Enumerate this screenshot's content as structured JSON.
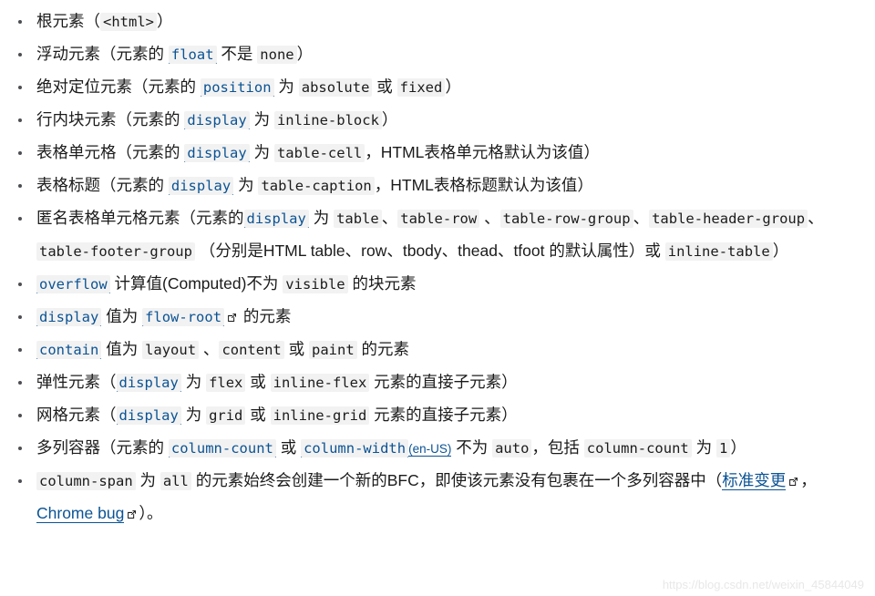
{
  "page": {
    "title": "BFC 触发条件列表",
    "text_color": "#1b1b1b",
    "link_color": "#0b5394",
    "code_background": "#f2f2f2",
    "background": "#ffffff",
    "watermark": "https://blog.csdn.net/weixin_45844049",
    "external_link_icon": "external-link-icon"
  },
  "list": {
    "items": [
      {
        "id": "root-element",
        "parts": [
          {
            "type": "text",
            "value": "根元素（"
          },
          {
            "type": "code",
            "value": "<html>"
          },
          {
            "type": "text",
            "value": "）"
          }
        ]
      },
      {
        "id": "floated-element",
        "parts": [
          {
            "type": "text",
            "value": "浮动元素（元素的 "
          },
          {
            "type": "codelink",
            "value": "float"
          },
          {
            "type": "text",
            "value": " 不是 "
          },
          {
            "type": "code",
            "value": "none"
          },
          {
            "type": "text",
            "value": "）"
          }
        ]
      },
      {
        "id": "absolutely-positioned-element",
        "parts": [
          {
            "type": "text",
            "value": "绝对定位元素（元素的 "
          },
          {
            "type": "codelink",
            "value": "position"
          },
          {
            "type": "text",
            "value": " 为 "
          },
          {
            "type": "code",
            "value": "absolute"
          },
          {
            "type": "text",
            "value": " 或 "
          },
          {
            "type": "code",
            "value": "fixed"
          },
          {
            "type": "text",
            "value": "）"
          }
        ]
      },
      {
        "id": "inline-block-element",
        "parts": [
          {
            "type": "text",
            "value": "行内块元素（元素的 "
          },
          {
            "type": "codelink",
            "value": "display"
          },
          {
            "type": "text",
            "value": " 为 "
          },
          {
            "type": "code",
            "value": "inline-block"
          },
          {
            "type": "text",
            "value": "）"
          }
        ]
      },
      {
        "id": "table-cell",
        "parts": [
          {
            "type": "text",
            "value": "表格单元格（元素的 "
          },
          {
            "type": "codelink",
            "value": "display"
          },
          {
            "type": "text",
            "value": " 为 "
          },
          {
            "type": "code",
            "value": "table-cell"
          },
          {
            "type": "text",
            "value": "，HTML表格单元格默认为该值）"
          }
        ]
      },
      {
        "id": "table-caption",
        "parts": [
          {
            "type": "text",
            "value": "表格标题（元素的 "
          },
          {
            "type": "codelink",
            "value": "display"
          },
          {
            "type": "text",
            "value": " 为 "
          },
          {
            "type": "code",
            "value": "table-caption"
          },
          {
            "type": "text",
            "value": "，HTML表格标题默认为该值）"
          }
        ]
      },
      {
        "id": "anonymous-table-cell",
        "parts": [
          {
            "type": "text",
            "value": "匿名表格单元格元素（元素的"
          },
          {
            "type": "codelink",
            "value": "display"
          },
          {
            "type": "text",
            "value": " 为 "
          },
          {
            "type": "code",
            "value": "table"
          },
          {
            "type": "text",
            "value": "、"
          },
          {
            "type": "code",
            "value": "table-row"
          },
          {
            "type": "text",
            "value": " 、"
          },
          {
            "type": "code",
            "value": "table-row-group"
          },
          {
            "type": "text",
            "value": "、"
          },
          {
            "type": "code",
            "value": "table-header-group"
          },
          {
            "type": "text",
            "value": "、"
          },
          {
            "type": "code",
            "value": "table-footer-group"
          },
          {
            "type": "text",
            "value": " （分别是HTML table、row、tbody、thead、tfoot 的默认属性）或 "
          },
          {
            "type": "code",
            "value": "inline-table"
          },
          {
            "type": "text",
            "value": "）"
          }
        ]
      },
      {
        "id": "overflow-not-visible",
        "parts": [
          {
            "type": "codelink",
            "value": "overflow"
          },
          {
            "type": "text",
            "value": " 计算值(Computed)不为 "
          },
          {
            "type": "code",
            "value": "visible"
          },
          {
            "type": "text",
            "value": " 的块元素"
          }
        ]
      },
      {
        "id": "display-flow-root",
        "parts": [
          {
            "type": "codelink",
            "value": "display"
          },
          {
            "type": "text",
            "value": " 值为 "
          },
          {
            "type": "codelink",
            "value": "flow-root",
            "external": true
          },
          {
            "type": "text",
            "value": " 的元素"
          }
        ]
      },
      {
        "id": "contain-values",
        "parts": [
          {
            "type": "codelink",
            "value": "contain"
          },
          {
            "type": "text",
            "value": " 值为 "
          },
          {
            "type": "code",
            "value": "layout"
          },
          {
            "type": "text",
            "value": " 、"
          },
          {
            "type": "code",
            "value": "content"
          },
          {
            "type": "text",
            "value": " 或 "
          },
          {
            "type": "code",
            "value": "paint"
          },
          {
            "type": "text",
            "value": " 的元素"
          }
        ]
      },
      {
        "id": "flex-item",
        "parts": [
          {
            "type": "text",
            "value": "弹性元素（"
          },
          {
            "type": "codelink",
            "value": "display"
          },
          {
            "type": "text",
            "value": " 为 "
          },
          {
            "type": "code",
            "value": "flex"
          },
          {
            "type": "text",
            "value": " 或 "
          },
          {
            "type": "code",
            "value": "inline-flex"
          },
          {
            "type": "text",
            "value": " 元素的直接子元素）"
          }
        ]
      },
      {
        "id": "grid-item",
        "parts": [
          {
            "type": "text",
            "value": "网格元素（"
          },
          {
            "type": "codelink",
            "value": "display"
          },
          {
            "type": "text",
            "value": " 为 "
          },
          {
            "type": "code",
            "value": "grid"
          },
          {
            "type": "text",
            "value": " 或 "
          },
          {
            "type": "code",
            "value": "inline-grid"
          },
          {
            "type": "text",
            "value": " 元素的直接子元素）"
          }
        ]
      },
      {
        "id": "multicol-container",
        "parts": [
          {
            "type": "text",
            "value": "多列容器（元素的 "
          },
          {
            "type": "codelink",
            "value": "column-count"
          },
          {
            "type": "text",
            "value": " 或 "
          },
          {
            "type": "codelink",
            "value": "column-width"
          },
          {
            "type": "enus",
            "value": "(en-US)"
          },
          {
            "type": "text",
            "value": " 不为 "
          },
          {
            "type": "code",
            "value": "auto"
          },
          {
            "type": "text",
            "value": "，包括 "
          },
          {
            "type": "code",
            "value": "column-count"
          },
          {
            "type": "text",
            "value": " 为 "
          },
          {
            "type": "code",
            "value": "1"
          },
          {
            "type": "text",
            "value": "）"
          }
        ]
      },
      {
        "id": "column-span-all",
        "parts": [
          {
            "type": "code",
            "value": "column-span"
          },
          {
            "type": "text",
            "value": " 为 "
          },
          {
            "type": "code",
            "value": "all"
          },
          {
            "type": "text",
            "value": " 的元素始终会创建一个新的BFC，即使该元素没有包裹在一个多列容器中（"
          },
          {
            "type": "link",
            "value": "标准变更",
            "external": true
          },
          {
            "type": "text",
            "value": "， "
          },
          {
            "type": "link",
            "value": "Chrome bug",
            "external": true
          },
          {
            "type": "text",
            "value": "）。"
          }
        ]
      }
    ]
  }
}
